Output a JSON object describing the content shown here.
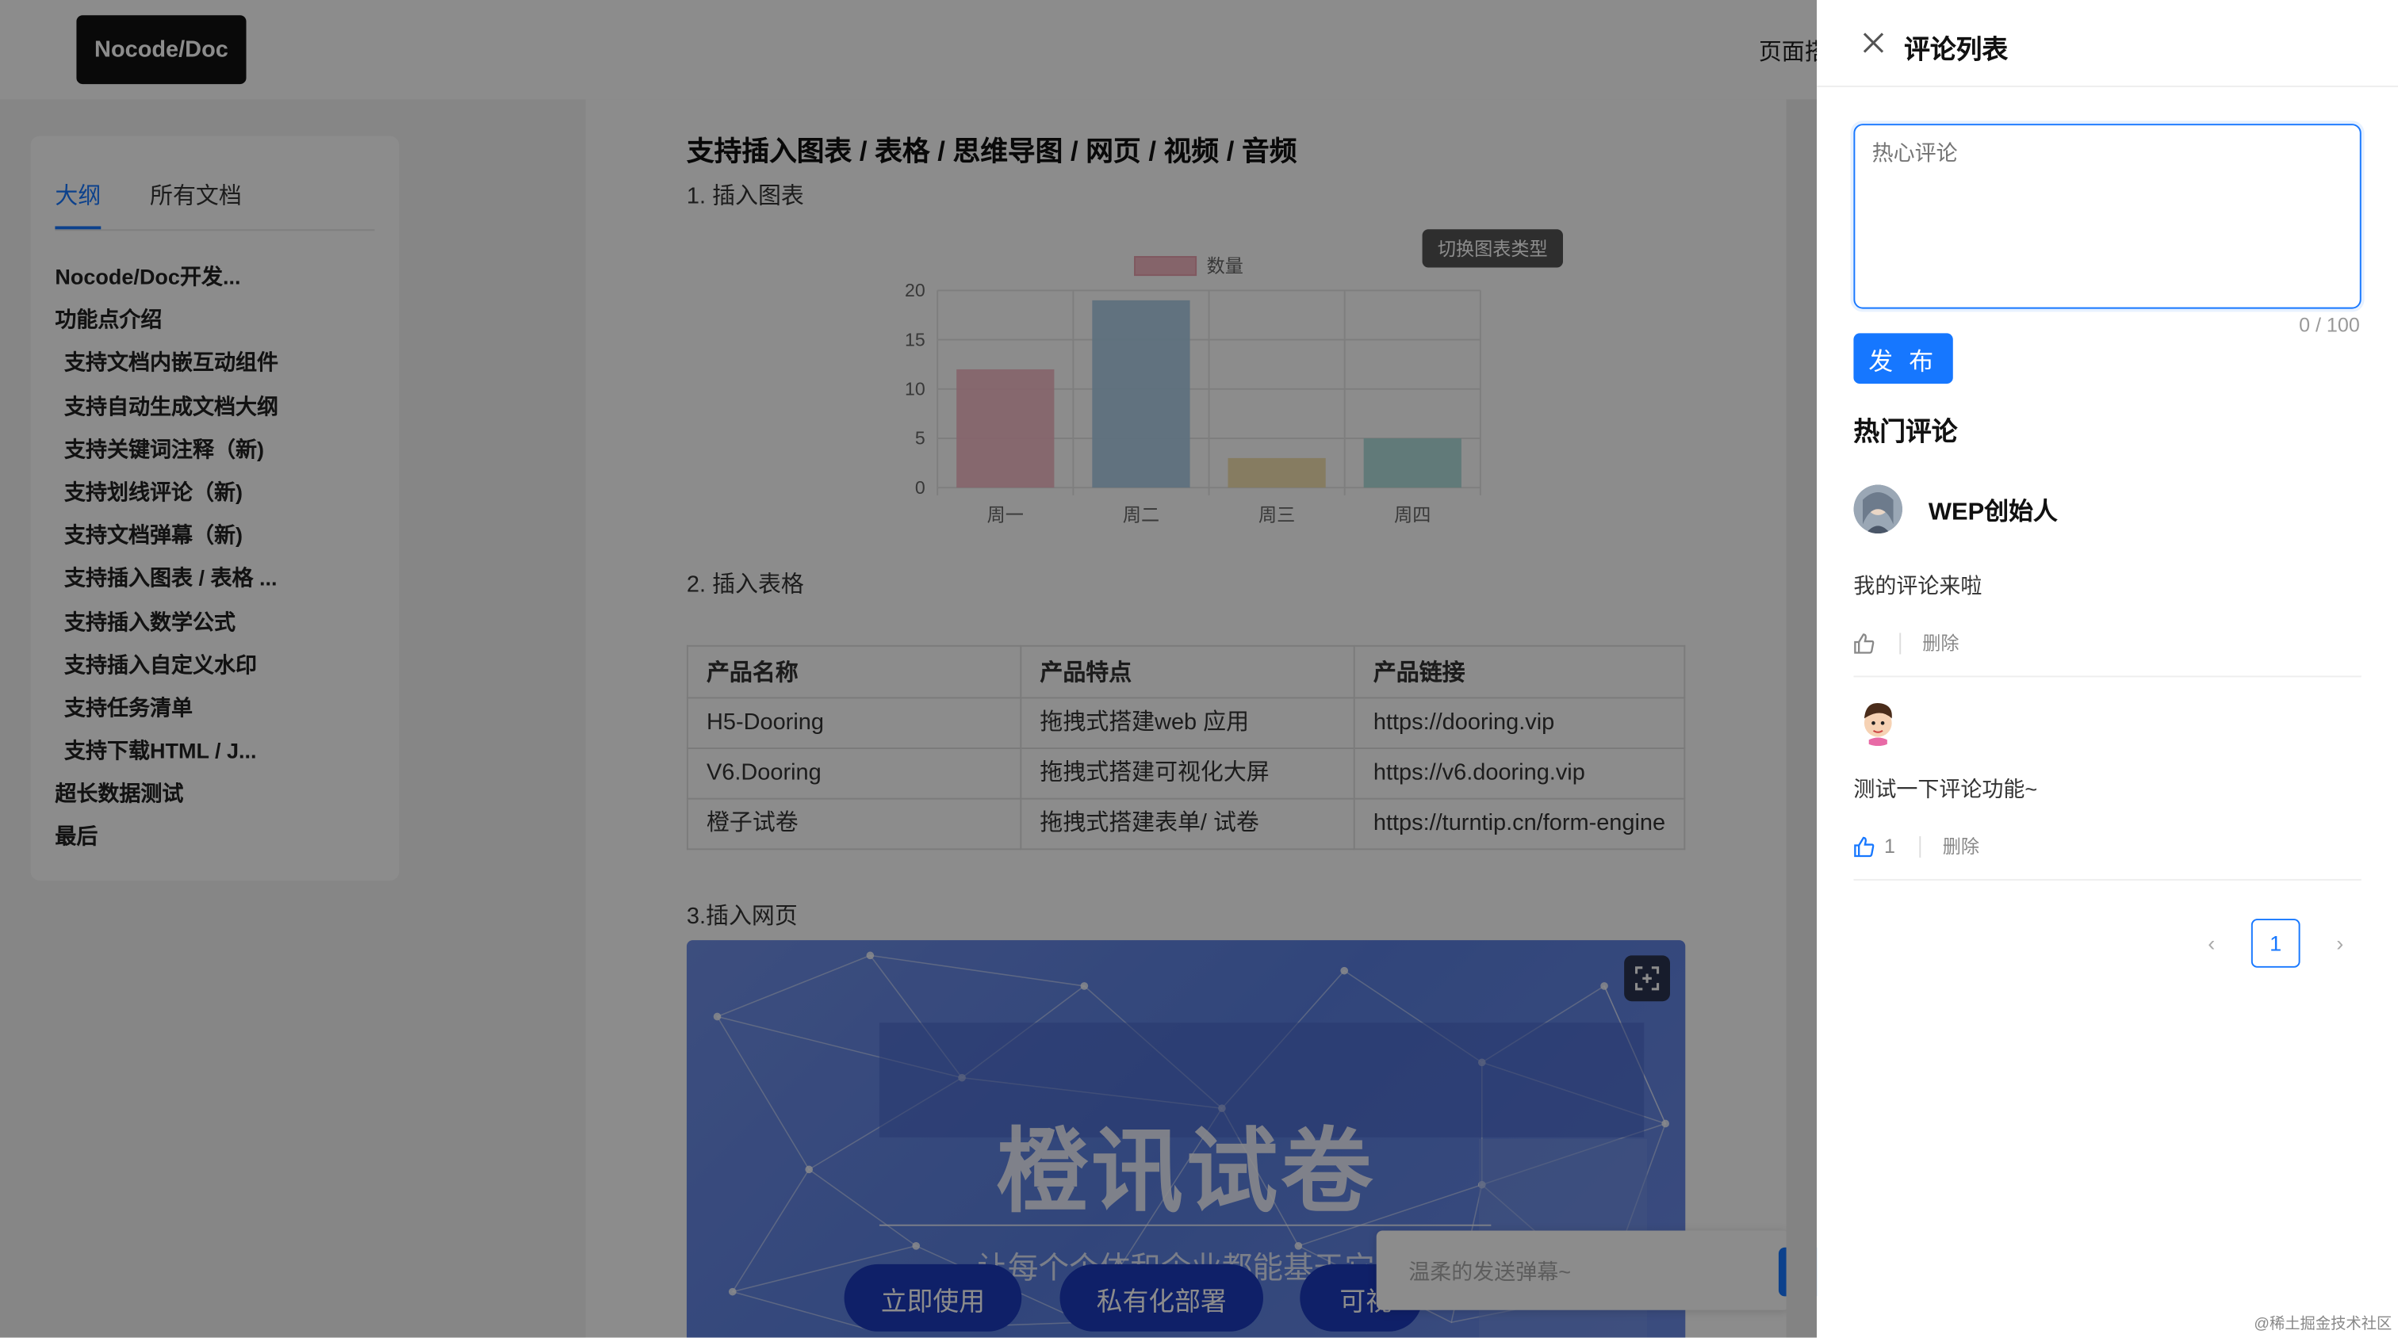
{
  "header": {
    "logo": "Nocode/Doc",
    "link": "页面搭"
  },
  "outline": {
    "tabs": [
      {
        "label": "大纲"
      },
      {
        "label": "所有文档"
      }
    ],
    "items": [
      {
        "label": "Nocode/Doc开发..."
      },
      {
        "label": "功能点介绍"
      },
      {
        "label": "支持文档内嵌互动组件"
      },
      {
        "label": "支持自动生成文档大纲"
      },
      {
        "label": "支持关键词注释（新)"
      },
      {
        "label": "支持划线评论（新)"
      },
      {
        "label": "支持文档弹幕（新)"
      },
      {
        "label": "支持插入图表 / 表格 ..."
      },
      {
        "label": "支持插入数学公式"
      },
      {
        "label": "支持插入自定义水印"
      },
      {
        "label": "支持任务清单"
      },
      {
        "label": "支持下载HTML / J..."
      },
      {
        "label": "超长数据测试"
      },
      {
        "label": "最后"
      }
    ]
  },
  "main": {
    "section_title": "支持插入图表 / 表格 / 思维导图 / 网页 / 视频 / 音频",
    "item1": "1. 插入图表",
    "chart_button": "切换图表类型",
    "item2": "2. 插入表格",
    "item3": "3.插入网页",
    "table": {
      "headers": [
        "产品名称",
        "产品特点",
        "产品链接"
      ],
      "rows": [
        [
          "H5-Dooring",
          "拖拽式搭建web 应用",
          "https://dooring.vip"
        ],
        [
          "V6.Dooring",
          "拖拽式搭建可视化大屏",
          "https://v6.dooring.vip"
        ],
        [
          "橙子试卷",
          "拖拽式搭建表单/ 试卷",
          "https://turntip.cn/form-engine"
        ]
      ]
    },
    "embed": {
      "title": "橙讯试卷",
      "subtitle": "让每个个体和企业都能基于它",
      "buttons": [
        {
          "label": "立即使用"
        },
        {
          "label": "私有化部署"
        },
        {
          "label": "可视"
        }
      ]
    },
    "danmu_placeholder": "温柔的发送弹幕~"
  },
  "chart_data": {
    "type": "bar",
    "categories": [
      "周一",
      "周二",
      "周三",
      "周四"
    ],
    "series": [
      {
        "name": "数量",
        "values": [
          12,
          19,
          3,
          5
        ]
      }
    ],
    "yticks": [
      "0",
      "5",
      "10",
      "15",
      "20"
    ],
    "ylim": [
      0,
      20
    ],
    "grid": true,
    "legend": "top",
    "colors": [
      "#f3b6c2",
      "#a9cbe6",
      "#f3dfa9",
      "#a8dbd8"
    ]
  },
  "drawer": {
    "title": "评论列表",
    "textarea_placeholder": "热心评论",
    "counter": "0 / 100",
    "publish": "发 布",
    "hot_title": "热门评论",
    "comments": [
      {
        "author": "WEP创始人",
        "text": "我的评论来啦",
        "likes": "",
        "delete": "删除"
      },
      {
        "author": "",
        "text": "测试一下评论功能~",
        "likes": "1",
        "delete": "删除"
      }
    ],
    "pagination": {
      "current": "1"
    }
  },
  "watermark": "@稀土掘金技术社区"
}
